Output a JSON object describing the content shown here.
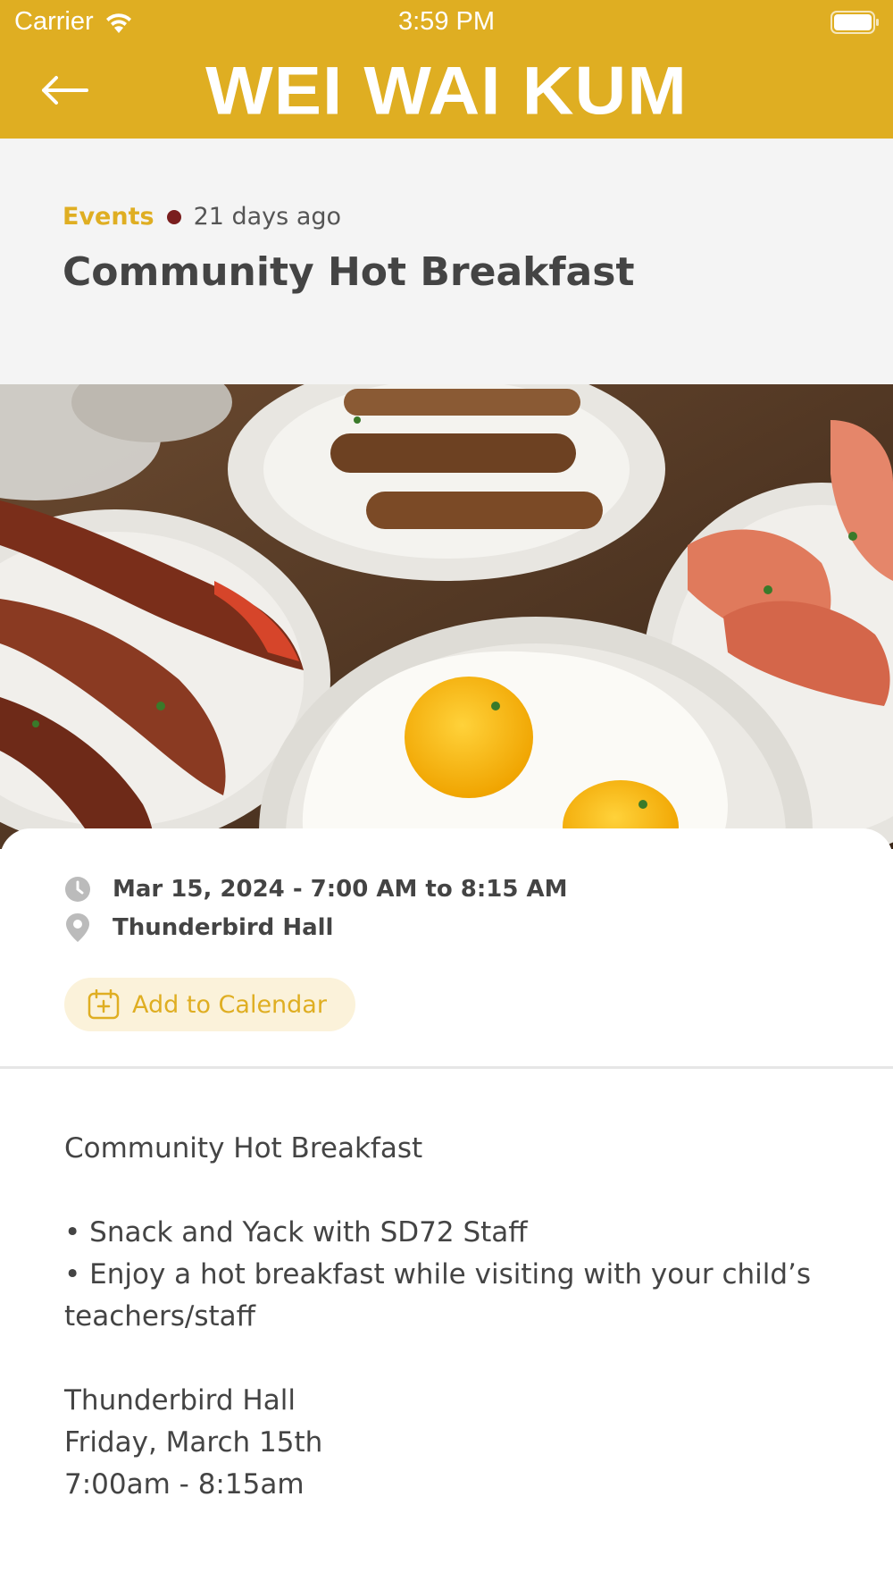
{
  "status_bar": {
    "carrier": "Carrier",
    "time": "3:59 PM"
  },
  "header": {
    "brand": "WEI WAI KUM",
    "background_color": "#DFAE22",
    "back_icon": "arrow-left-icon"
  },
  "article": {
    "category": "Events",
    "age": "21 days ago",
    "title": "Community Hot Breakfast",
    "category_color": "#DFAE22",
    "dot_color": "#7A1E1E"
  },
  "hero": {
    "icon": "breakfast-photo"
  },
  "details": {
    "datetime": "Mar 15, 2024 - 7:00 AM to 8:15 AM",
    "location": "Thunderbird Hall",
    "clock_icon": "clock-icon",
    "location_icon": "location-pin-icon"
  },
  "calendar_button": {
    "label": "Add to Calendar",
    "icon": "calendar-add-icon"
  },
  "description": {
    "heading": "Community Hot Breakfast",
    "bullets": [
      "• Snack and Yack with SD72 Staff",
      "• Enjoy a hot breakfast while visiting with your child’s teachers/staff"
    ],
    "venue": "Thunderbird Hall",
    "date": "Friday, March 15th",
    "time": "7:00am - 8:15am"
  }
}
